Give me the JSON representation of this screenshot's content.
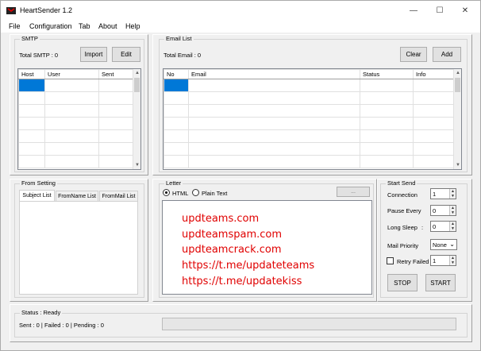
{
  "window": {
    "title": "HeartSender 1.2",
    "minimize": "—",
    "maximize": "☐",
    "close": "✕"
  },
  "menu": [
    "File",
    "Configuration",
    "Tab",
    "About",
    "Help"
  ],
  "smtp": {
    "group_title": "SMTP",
    "total_label": "Total SMTP : 0",
    "import_label": "Import",
    "edit_label": "Edit",
    "columns": [
      "Host",
      "User",
      "Sent"
    ]
  },
  "email_list": {
    "group_title": "Email List",
    "total_label": "Total Email : 0",
    "clear_label": "Clear",
    "add_label": "Add",
    "columns": [
      "No",
      "Email",
      "Status",
      "Info"
    ]
  },
  "from_setting": {
    "group_title": "From Setting",
    "tabs": [
      "Subject List",
      "FromName List",
      "FromMail List"
    ],
    "active_tab": "Subject List"
  },
  "letter": {
    "group_title": "Letter",
    "html_label": "HTML",
    "plain_label": "Plain Text",
    "browse_label": "...",
    "mode": "HTML",
    "lines": [
      "updteams.com",
      "updteamspam.com",
      "updteamcrack.com",
      "https://t.me/updateteams",
      "https://t.me/updatekiss"
    ]
  },
  "start_send": {
    "group_title": "Start Send",
    "connection_label": "Connection",
    "connection_value": "1",
    "pause_label": "Pause Every",
    "pause_value": "0",
    "sleep_label": "Long Sleep",
    "sleep_sep": ":",
    "sleep_value": "0",
    "priority_label": "Mail Priority",
    "priority_value": "None",
    "retry_label": "Retry Failed",
    "retry_value": "1",
    "retry_checked": false,
    "stop_label": "STOP",
    "start_label": "START"
  },
  "status": {
    "group_title": "Status : Ready",
    "counts": "Sent : 0 | Failed : 0 | Pending : 0",
    "progress": 0
  },
  "colors": {
    "selection": "#0078d7",
    "letter_text": "#e00000",
    "window_bg": "#f0f0f0"
  }
}
